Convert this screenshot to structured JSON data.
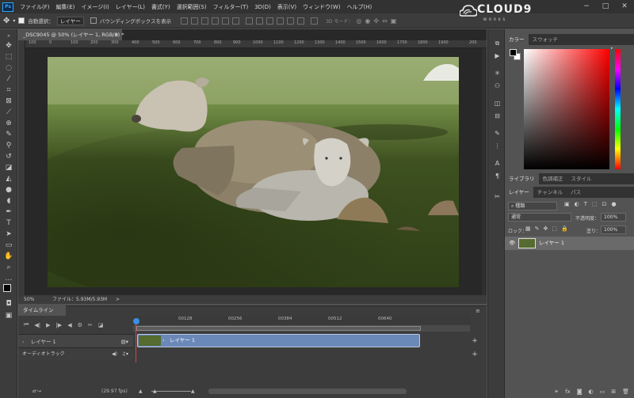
{
  "app": {
    "logo": "Ps"
  },
  "menu": [
    "ファイル(F)",
    "編集(E)",
    "イメージ(I)",
    "レイヤー(L)",
    "書式(Y)",
    "選択範囲(S)",
    "フィルター(T)",
    "3D(D)",
    "表示(V)",
    "ウィンドウ(W)",
    "ヘルプ(H)"
  ],
  "window_controls": {
    "minimize": "−",
    "maximize": "□",
    "close": "✕"
  },
  "optionsbar": {
    "auto_select_label": "自動選択：",
    "auto_select_value": "レイヤー",
    "bbox_label": "バウンディングボックスを表示",
    "mode_3d": "3D モード："
  },
  "logo": {
    "brand": "CLOUD9",
    "sub": "WORKS"
  },
  "document": {
    "tab_title": "_DSC9045 @ 50% (レイヤー 1, RGB/8) *",
    "tab_close": "×",
    "ruler_ticks": [
      "100",
      "0",
      "100",
      "200",
      "300",
      "400",
      "500",
      "600",
      "700",
      "800",
      "900",
      "1000",
      "1100",
      "1200",
      "1300",
      "1400",
      "1500",
      "1600",
      "1700",
      "1800",
      "1900",
      "200"
    ],
    "zoom": "50%",
    "file_info": "ファイル：5.93M/5.93M",
    "status_arrow": ">"
  },
  "timeline": {
    "tab": "タイムライン",
    "ruler": [
      "00128",
      "00256",
      "00384",
      "00512",
      "00640"
    ],
    "track1_label": "レイヤー 1",
    "track2_label": "オーディオトラック",
    "clip_label": "レイヤー 1",
    "fps": "(29.97 fps)"
  },
  "color_panel": {
    "tabs": [
      "カラー",
      "スウォッチ"
    ]
  },
  "lib_panel": {
    "tabs": [
      "ライブラリ",
      "色調補正",
      "スタイル"
    ]
  },
  "layers_panel": {
    "tabs": [
      "レイヤー",
      "チャンネル",
      "パス"
    ],
    "filter": "種類",
    "blend_mode": "通常",
    "opacity_label": "不透明度：",
    "opacity_value": "100%",
    "lock_label": "ロック：",
    "fill_label": "塗り：",
    "fill_value": "100%",
    "layer_name": "レイヤー 1",
    "bottom_icons": [
      "fx"
    ]
  }
}
